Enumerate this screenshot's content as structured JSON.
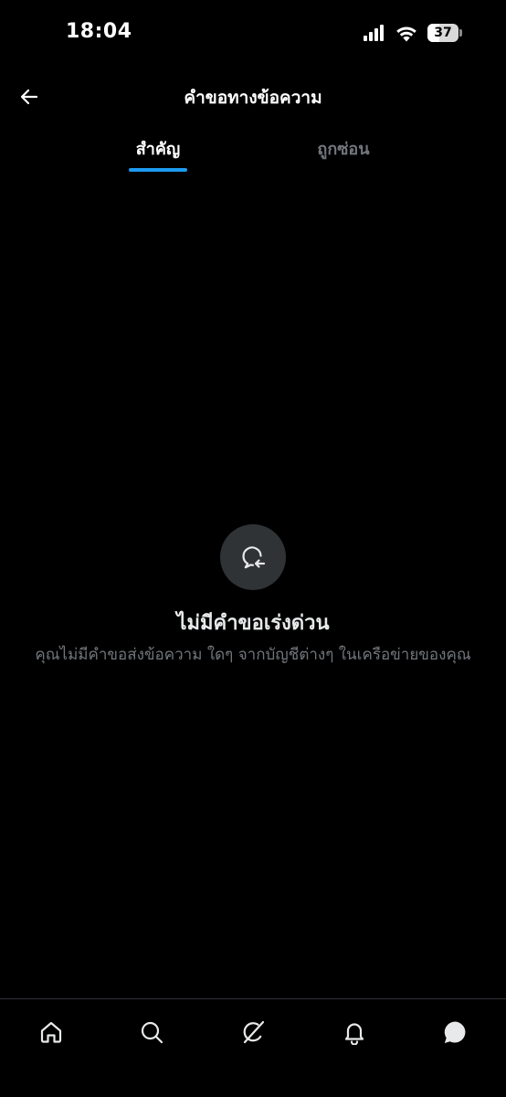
{
  "status_bar": {
    "time": "18:04",
    "battery_percent": "37",
    "battery_level": 0.37
  },
  "header": {
    "title": "คำขอทางข้อความ",
    "back_icon": "arrow-left-icon"
  },
  "tabs": [
    {
      "label": "สำคัญ",
      "active": true
    },
    {
      "label": "ถูกซ่อน",
      "active": false
    }
  ],
  "empty_state": {
    "icon": "message-request-icon",
    "title": "ไม่มีคำขอเร่งด่วน",
    "description": "คุณไม่มีคำขอส่งข้อความ ใดๆ จากบัญชีต่างๆ ในเครือข่ายของคุณ"
  },
  "bottom_nav": {
    "items": [
      {
        "icon": "home-icon"
      },
      {
        "icon": "search-icon"
      },
      {
        "icon": "grok-icon"
      },
      {
        "icon": "bell-icon"
      },
      {
        "icon": "messages-icon",
        "active": true
      }
    ]
  },
  "colors": {
    "background": "#000000",
    "accent": "#1d9bf0",
    "muted_text": "#71767b",
    "icon_circle": "#2f3336"
  }
}
